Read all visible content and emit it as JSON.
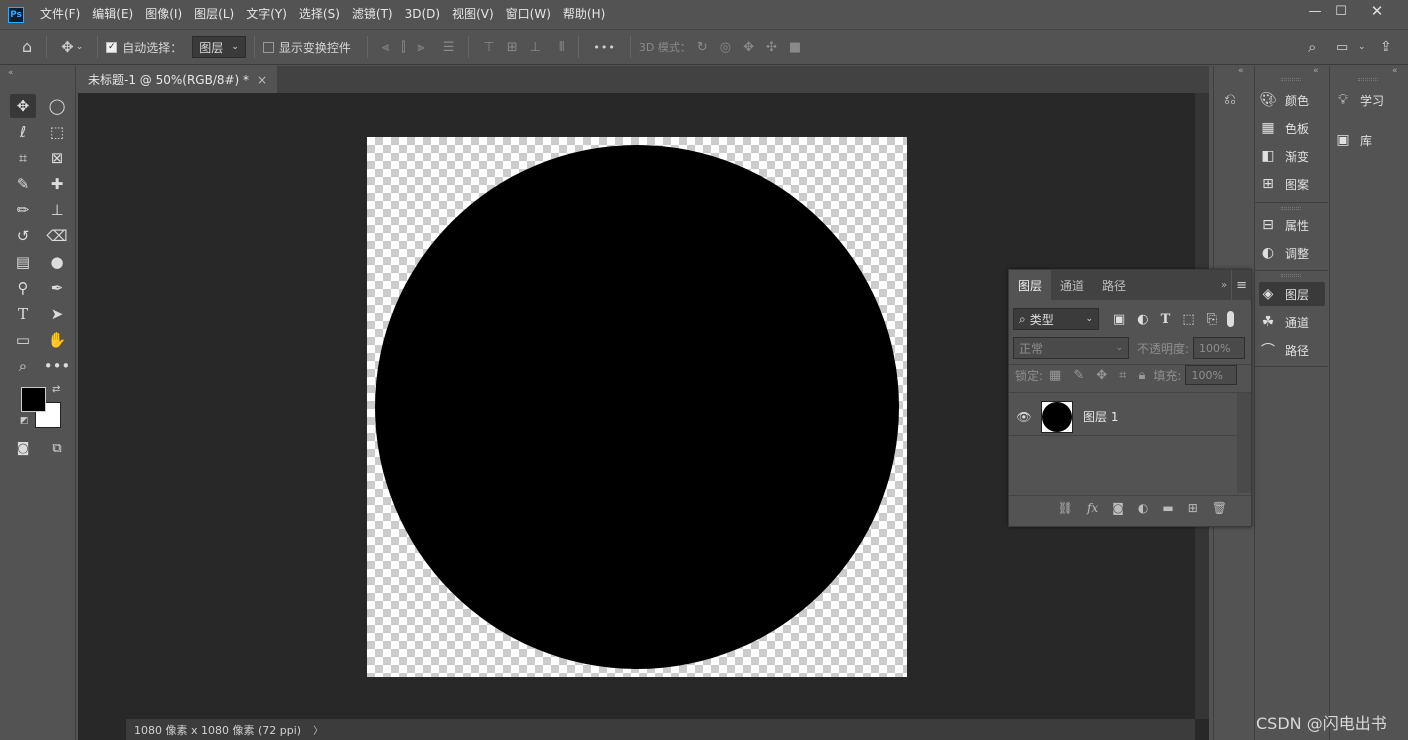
{
  "app": {
    "logo": "Ps"
  },
  "menu": [
    "文件(F)",
    "编辑(E)",
    "图像(I)",
    "图层(L)",
    "文字(Y)",
    "选择(S)",
    "滤镜(T)",
    "3D(D)",
    "视图(V)",
    "窗口(W)",
    "帮助(H)"
  ],
  "window_controls": {
    "minimize": "—",
    "maximize": "☐",
    "close": "✕"
  },
  "options": {
    "auto_select_label": "自动选择：",
    "auto_select_checked": true,
    "auto_select_target": "图层",
    "show_transform_label": "显示变换控件",
    "show_transform_checked": false,
    "more": "•••",
    "mode_3d_label": "3D 模式："
  },
  "document": {
    "tab_title": "未标题-1 @ 50%(RGB/8#) *",
    "tab_close": "×",
    "status": "1080 像素 x 1080 像素 (72 ppi)",
    "status_arrow": "〉"
  },
  "panels_right": {
    "group1": [
      {
        "icon": "palette-icon",
        "label": "颜色"
      },
      {
        "icon": "swatches-icon",
        "label": "色板"
      },
      {
        "icon": "gradient-icon",
        "label": "渐变"
      },
      {
        "icon": "patterns-icon",
        "label": "图案"
      }
    ],
    "group2": [
      {
        "icon": "properties-icon",
        "label": "属性"
      },
      {
        "icon": "adjustments-icon",
        "label": "调整"
      }
    ],
    "group3": [
      {
        "icon": "layers-icon",
        "label": "图层"
      },
      {
        "icon": "channels-icon",
        "label": "通道"
      },
      {
        "icon": "paths-icon",
        "label": "路径"
      }
    ],
    "group4": [
      {
        "icon": "learn-icon",
        "label": "学习"
      },
      {
        "icon": "libraries-icon",
        "label": "库"
      }
    ]
  },
  "layers_panel": {
    "tabs": [
      "图层",
      "通道",
      "路径"
    ],
    "active_tab": "图层",
    "filter_label": "类型",
    "blend_mode": "正常",
    "opacity_label": "不透明度:",
    "opacity_value": "100%",
    "lock_label": "锁定:",
    "fill_label": "填充:",
    "fill_value": "100%",
    "layers": [
      {
        "name": "图层 1",
        "visible": true
      }
    ],
    "footer_fx": "fx"
  },
  "watermark": "CSDN @闪电出书"
}
